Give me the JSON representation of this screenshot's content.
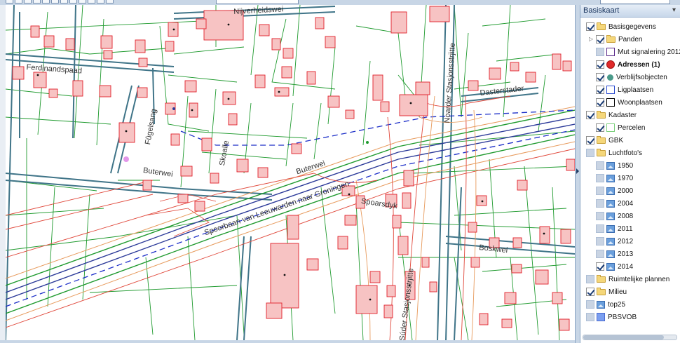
{
  "app": {
    "accent_color": "#2a4f80",
    "toolbar_button_count": 12
  },
  "layer_panel": {
    "title": "Basiskaart",
    "items": [
      {
        "label": "Basisgegevens",
        "icon": "folder",
        "checked": true,
        "level": 0,
        "bold": false,
        "expander": false
      },
      {
        "label": "Panden",
        "icon": "folder",
        "checked": true,
        "level": 1,
        "bold": false,
        "expander": true
      },
      {
        "label": "Mut signalering 2012",
        "icon": "legend-square-purple",
        "checked": false,
        "level": 1,
        "bold": false,
        "expander": false
      },
      {
        "label": "Adressen (1)",
        "icon": "legend-dot-red",
        "checked": true,
        "level": 1,
        "bold": true,
        "expander": false
      },
      {
        "label": "Verblijfsobjecten",
        "icon": "legend-dot-teal",
        "checked": true,
        "level": 1,
        "bold": false,
        "expander": false
      },
      {
        "label": "Ligplaatsen",
        "icon": "legend-square-blue",
        "checked": true,
        "level": 1,
        "bold": false,
        "expander": false
      },
      {
        "label": "Woonplaatsen",
        "icon": "legend-square-black",
        "checked": true,
        "level": 1,
        "bold": false,
        "expander": false
      },
      {
        "label": "Kadaster",
        "icon": "folder",
        "checked": true,
        "level": 0,
        "bold": false,
        "expander": false
      },
      {
        "label": "Percelen",
        "icon": "legend-square-green",
        "checked": true,
        "level": 1,
        "bold": false,
        "expander": false
      },
      {
        "label": "GBK",
        "icon": "folder",
        "checked": true,
        "level": 0,
        "bold": false,
        "expander": false
      },
      {
        "label": "Luchtfoto's",
        "icon": "folder",
        "checked": false,
        "level": 0,
        "bold": false,
        "expander": false
      },
      {
        "label": "1950",
        "icon": "photo",
        "checked": false,
        "level": 1,
        "bold": false,
        "expander": false
      },
      {
        "label": "1970",
        "icon": "photo",
        "checked": false,
        "level": 1,
        "bold": false,
        "expander": false
      },
      {
        "label": "2000",
        "icon": "photo",
        "checked": false,
        "level": 1,
        "bold": false,
        "expander": false
      },
      {
        "label": "2004",
        "icon": "photo",
        "checked": false,
        "level": 1,
        "bold": false,
        "expander": false
      },
      {
        "label": "2008",
        "icon": "photo",
        "checked": false,
        "level": 1,
        "bold": false,
        "expander": false
      },
      {
        "label": "2011",
        "icon": "photo",
        "checked": false,
        "level": 1,
        "bold": false,
        "expander": false
      },
      {
        "label": "2012",
        "icon": "photo",
        "checked": false,
        "level": 1,
        "bold": false,
        "expander": false
      },
      {
        "label": "2013",
        "icon": "photo",
        "checked": false,
        "level": 1,
        "bold": false,
        "expander": false
      },
      {
        "label": "2014",
        "icon": "photo",
        "checked": true,
        "level": 1,
        "bold": false,
        "expander": false
      },
      {
        "label": "Ruimtelijke plannen",
        "icon": "folder",
        "checked": false,
        "level": 0,
        "bold": false,
        "expander": false
      },
      {
        "label": "Milieu",
        "icon": "folder",
        "checked": true,
        "level": 0,
        "bold": false,
        "expander": false
      },
      {
        "label": "top25",
        "icon": "photo",
        "checked": false,
        "level": 0,
        "bold": false,
        "expander": false
      },
      {
        "label": "PBSVOB",
        "icon": "legend-square-cornflower",
        "checked": false,
        "level": 0,
        "bold": false,
        "expander": false
      }
    ]
  },
  "map": {
    "colors": {
      "building": "#f7c3c3",
      "building_stroke": "#e0202a",
      "parcel": "#1f9a2e",
      "road_edge": "#3f7488",
      "railway": "#2c3a99",
      "contour_red": "#e0473a",
      "contour_orange": "#e79a5c",
      "dashed_blue": "#1d2fc8"
    },
    "street_labels": {
      "ferdinandspaad": "Ferdinandspaad",
      "nijverheidswei": "Nijverheidswei",
      "fugelsang": "Fûgelsang",
      "skoalle": "Skoalle",
      "buterwei_left": "Buterwei",
      "buterwei_right": "Buterwei",
      "spoorbaan": "Spoorbaan van Leeuwarden naar Groningen",
      "spoarsdyk": "Spoarsdyk",
      "noarder_stasjonsstrjitte": "Noarder Stasjonsstrjitte",
      "suder_stasjonsstrjitte": "Súder Stasjonsstrjitte",
      "dasterstader": "Dasterstader",
      "boskwei": "Boskwei"
    }
  }
}
